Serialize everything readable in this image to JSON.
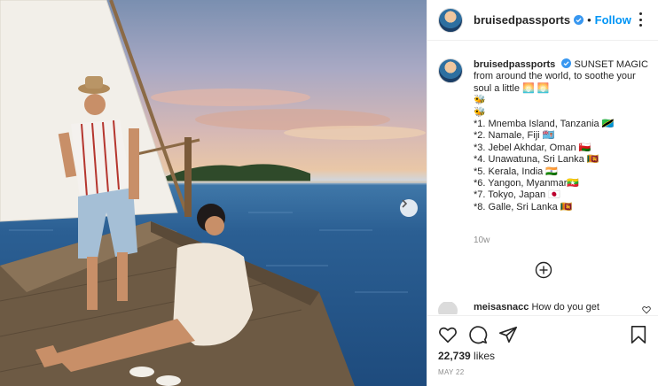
{
  "post": {
    "username": "bruisedpassports",
    "separator": "•",
    "follow_label": "Follow",
    "caption_headline": "SUNSET MAGIC from around the world, to soothe your soul a little 🌅 🌅",
    "caption_bees": [
      "🐝",
      "🐝"
    ],
    "caption_lines": [
      "*1. Mnemba Island, Tanzania 🇹🇿",
      "*2. Namale, Fiji 🇫🇯",
      "*3. Jebel Akhdar, Oman 🇴🇲",
      "*4. Unawatuna, Sri Lanka 🇱🇰",
      "*5. Kerala, India 🇮🇳",
      "*6. Yangon, Myanmar🇲🇲",
      "*7. Tokyo, Japan 🇯🇵",
      "*8. Galle, Sri Lanka 🇱🇰"
    ],
    "caption_age": "10w"
  },
  "comment": {
    "username": "meisasnacc",
    "text": "How do you get"
  },
  "stats": {
    "likes_count": "22,739",
    "likes_label": "likes",
    "date": "MAY 22"
  },
  "icons": {
    "more": "more-options-icon",
    "verified": "verified-badge-icon",
    "add_comment": "plus-circle-icon",
    "like": "heart-icon",
    "comment": "comment-bubble-icon",
    "share": "paper-plane-icon",
    "save": "bookmark-icon",
    "next": "chevron-right-icon"
  },
  "colors": {
    "accent": "#0095f6",
    "verified": "#3897f0",
    "muted": "#8e8e8e",
    "text": "#262626"
  }
}
